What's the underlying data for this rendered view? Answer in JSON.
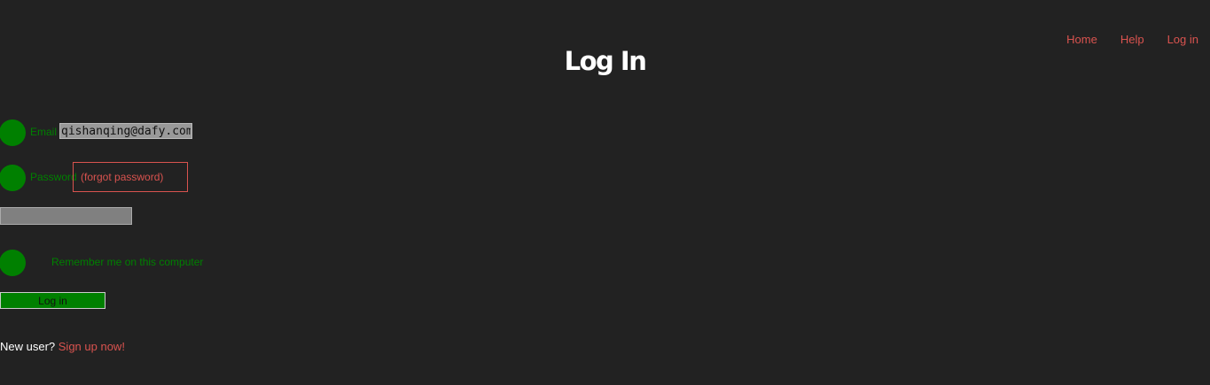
{
  "nav": {
    "items": [
      {
        "label": "Home"
      },
      {
        "label": "Help"
      },
      {
        "label": "Log in"
      }
    ]
  },
  "page": {
    "title": "Log In"
  },
  "form": {
    "email_label": "Email",
    "email_value": "qishanqing@dafy.com",
    "password_label": "Password",
    "forgot_label": "(forgot password)",
    "password_value": "",
    "remember_label": "Remember me on this computer",
    "submit_label": "Log in"
  },
  "signup": {
    "prompt": "New user?",
    "link_label": "Sign up now!"
  },
  "colors": {
    "background": "#222222",
    "accent_red": "#d9534f",
    "accent_green": "#008000",
    "title": "#ffffff"
  }
}
